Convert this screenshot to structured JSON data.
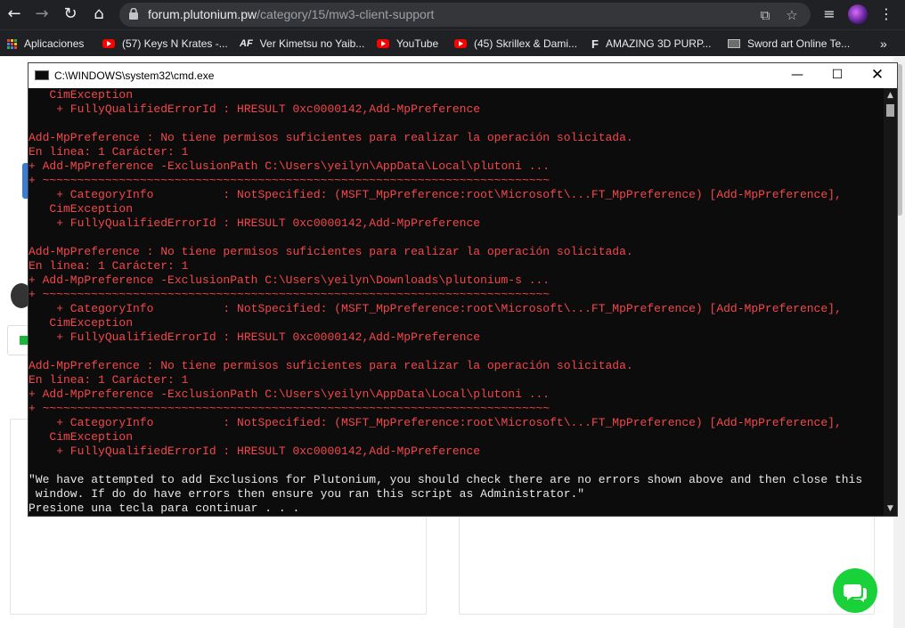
{
  "browser": {
    "url_host": "forum.plutonium.pw",
    "url_path": "/category/15/mw3-client-support",
    "bookmarks": [
      {
        "label": "Aplicaciones",
        "icon": "apps-grid-icon"
      },
      {
        "label": "(57) Keys N Krates -...",
        "icon": "youtube-icon"
      },
      {
        "label": "Ver Kimetsu no Yaib...",
        "icon": "af-icon"
      },
      {
        "label": "YouTube",
        "icon": "youtube-icon"
      },
      {
        "label": "(45) Skrillex & Dami...",
        "icon": "youtube-icon"
      },
      {
        "label": "AMAZING 3D PURP...",
        "icon": "f-logo-icon"
      },
      {
        "label": "Sword art Online Te...",
        "icon": "site-icon"
      }
    ],
    "more_label": "»"
  },
  "cmd": {
    "title": "C:\\WINDOWS\\system32\\cmd.exe",
    "lines": [
      {
        "t": "   CimException",
        "c": "red"
      },
      {
        "t": "    + FullyQualifiedErrorId : HRESULT 0xc0000142,Add-MpPreference",
        "c": "red"
      },
      {
        "t": "",
        "c": "red"
      },
      {
        "t": "Add-MpPreference : No tiene permisos suficientes para realizar la operación solicitada.",
        "c": "red"
      },
      {
        "t": "En línea: 1 Carácter: 1",
        "c": "red"
      },
      {
        "t": "+ Add-MpPreference -ExclusionPath C:\\Users\\yeilyn\\AppData\\Local\\plutoni ...",
        "c": "red"
      },
      {
        "t": "+ ~~~~~~~~~~~~~~~~~~~~~~~~~~~~~~~~~~~~~~~~~~~~~~~~~~~~~~~~~~~~~~~~~~~~~~~~~",
        "c": "red"
      },
      {
        "t": "    + CategoryInfo          : NotSpecified: (MSFT_MpPreference:root\\Microsoft\\...FT_MpPreference) [Add-MpPreference],",
        "c": "red"
      },
      {
        "t": "   CimException",
        "c": "red"
      },
      {
        "t": "    + FullyQualifiedErrorId : HRESULT 0xc0000142,Add-MpPreference",
        "c": "red"
      },
      {
        "t": "",
        "c": "red"
      },
      {
        "t": "Add-MpPreference : No tiene permisos suficientes para realizar la operación solicitada.",
        "c": "red"
      },
      {
        "t": "En línea: 1 Carácter: 1",
        "c": "red"
      },
      {
        "t": "+ Add-MpPreference -ExclusionPath C:\\Users\\yeilyn\\Downloads\\plutonium-s ...",
        "c": "red"
      },
      {
        "t": "+ ~~~~~~~~~~~~~~~~~~~~~~~~~~~~~~~~~~~~~~~~~~~~~~~~~~~~~~~~~~~~~~~~~~~~~~~~~",
        "c": "red"
      },
      {
        "t": "    + CategoryInfo          : NotSpecified: (MSFT_MpPreference:root\\Microsoft\\...FT_MpPreference) [Add-MpPreference],",
        "c": "red"
      },
      {
        "t": "   CimException",
        "c": "red"
      },
      {
        "t": "    + FullyQualifiedErrorId : HRESULT 0xc0000142,Add-MpPreference",
        "c": "red"
      },
      {
        "t": "",
        "c": "red"
      },
      {
        "t": "Add-MpPreference : No tiene permisos suficientes para realizar la operación solicitada.",
        "c": "red"
      },
      {
        "t": "En línea: 1 Carácter: 1",
        "c": "red"
      },
      {
        "t": "+ Add-MpPreference -ExclusionPath C:\\Users\\yeilyn\\AppData\\Local\\plutoni ...",
        "c": "red"
      },
      {
        "t": "+ ~~~~~~~~~~~~~~~~~~~~~~~~~~~~~~~~~~~~~~~~~~~~~~~~~~~~~~~~~~~~~~~~~~~~~~~~~",
        "c": "red"
      },
      {
        "t": "    + CategoryInfo          : NotSpecified: (MSFT_MpPreference:root\\Microsoft\\...FT_MpPreference) [Add-MpPreference],",
        "c": "red"
      },
      {
        "t": "   CimException",
        "c": "red"
      },
      {
        "t": "    + FullyQualifiedErrorId : HRESULT 0xc0000142,Add-MpPreference",
        "c": "red"
      },
      {
        "t": "",
        "c": "wht"
      },
      {
        "t": "\"We have attempted to add Exclusions for Plutonium, you should check there are no errors shown above and then close this",
        "c": "wht"
      },
      {
        "t": " window. If do do have errors then ensure you ran this script as Administrator.\"",
        "c": "wht"
      },
      {
        "t": "Presione una tecla para continuar . . .",
        "c": "wht"
      }
    ]
  },
  "colors": {
    "console_error": "#f4474b",
    "console_text": "#e8e8e8",
    "chat_button": "#19d23a"
  }
}
